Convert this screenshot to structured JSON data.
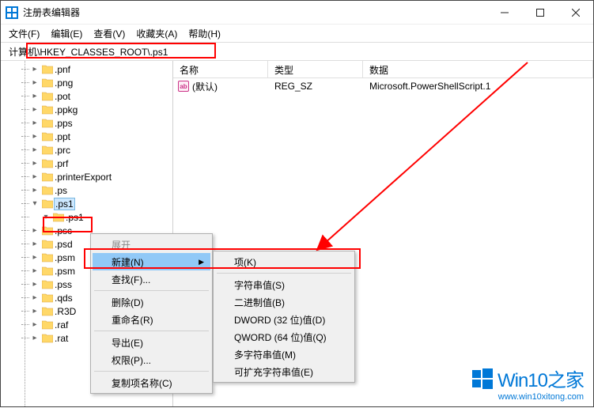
{
  "window": {
    "title": "注册表编辑器"
  },
  "menu": {
    "file": "文件(F)",
    "edit": "编辑(E)",
    "view": "查看(V)",
    "fav": "收藏夹(A)",
    "help": "帮助(H)"
  },
  "address": "计算机\\HKEY_CLASSES_ROOT\\.ps1",
  "cols": {
    "name": "名称",
    "type": "类型",
    "data": "数据"
  },
  "value_row": {
    "name": "(默认)",
    "type": "REG_SZ",
    "data": "Microsoft.PowerShellScript.1"
  },
  "tree": [
    ".pnf",
    ".png",
    ".pot",
    ".ppkg",
    ".pps",
    ".ppt",
    ".prc",
    ".prf",
    ".printerExport",
    ".ps",
    ".ps1",
    ".ps1",
    ".psc",
    ".psd",
    ".psm",
    ".psm",
    ".pss",
    ".qds",
    ".R3D",
    ".raf",
    ".rat"
  ],
  "ctx1": {
    "expand": "展开",
    "new": "新建(N)",
    "find": "查找(F)...",
    "delete": "删除(D)",
    "rename": "重命名(R)",
    "export": "导出(E)",
    "perm": "权限(P)...",
    "copy": "复制项名称(C)"
  },
  "ctx2": {
    "key": "项(K)",
    "string": "字符串值(S)",
    "binary": "二进制值(B)",
    "dword": "DWORD (32 位)值(D)",
    "qword": "QWORD (64 位)值(Q)",
    "multi": "多字符串值(M)",
    "expand": "可扩充字符串值(E)"
  },
  "watermark": {
    "brand": "Win10之家",
    "url": "www.win10xitong.com"
  }
}
